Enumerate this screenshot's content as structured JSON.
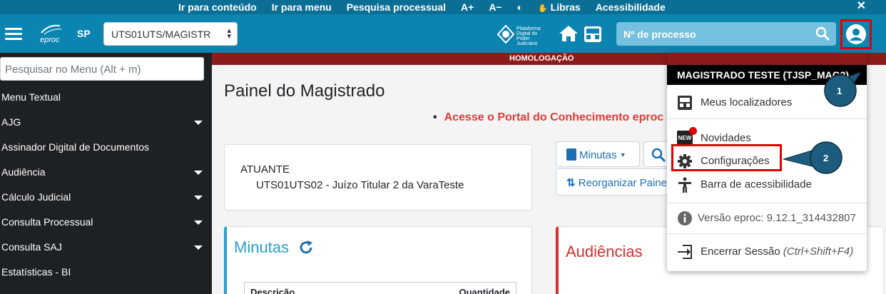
{
  "accessibility_bar": {
    "links": [
      "Ir para conteúdo",
      "Ir para menu",
      "Pesquisa processual",
      "A+",
      "A−",
      "◐",
      "Libras",
      "Acessibilidade"
    ],
    "close": "✕"
  },
  "header": {
    "logo_text": "eproc",
    "state": "SP",
    "unit_select_value": "UTS01UTS/MAGISTR",
    "pdpj_text": "Plataforma Digital do Poder Judiciário",
    "process_search_placeholder": "Nº de processo"
  },
  "sidebar": {
    "search_placeholder": "Pesquisar no Menu (Alt + m)",
    "items": [
      {
        "label": "Menu Textual",
        "expandable": false
      },
      {
        "label": "AJG",
        "expandable": true
      },
      {
        "label": "Assinador Digital de Documentos",
        "expandable": false
      },
      {
        "label": "Audiência",
        "expandable": true
      },
      {
        "label": "Cálculo Judicial",
        "expandable": true
      },
      {
        "label": "Consulta Processual",
        "expandable": true
      },
      {
        "label": "Consulta SAJ",
        "expandable": true
      },
      {
        "label": "Estatísticas - BI",
        "expandable": false
      }
    ]
  },
  "main": {
    "environment_banner": "HOMOLOGAÇÃO",
    "page_title": "Painel do Magistrado",
    "portal_link": "Acesse o Portal do Conhecimento eproc",
    "actuant_label": "ATUANTE",
    "actuant_value": "UTS01UTS02 - Juízo Titular 2 da VaraTeste",
    "minutas_button": "Minutas",
    "reorganize_button": "Reorganizar Painel",
    "minutas_panel_title": "Minutas",
    "minutas_table_col1": "Descrição",
    "minutas_table_col2": "Quantidade",
    "audiencias_panel_title": "Audiências"
  },
  "user_dropdown": {
    "user_name": "MAGISTRADO TESTE (TJSP_MAG2)",
    "items": {
      "localizadores": "Meus localizadores",
      "novidades": "Novidades",
      "novidades_badge": "NEW",
      "configuracoes": "Configurações",
      "acessibilidade": "Barra de acessibilidade",
      "versao": "Versão eproc: 9.12.1_314432807",
      "sair": "Encerrar Sessão",
      "sair_shortcut": "(Ctrl+Shift+F4)"
    }
  },
  "callouts": {
    "one": "1",
    "two": "2"
  },
  "colors": {
    "header_blue": "#0b84b0",
    "bar_blue": "#0b6e95",
    "sidebar_dark": "#1e2124",
    "highlight_red": "#e00000",
    "homologacao_red": "#8d1b1b",
    "callout_blue": "#1c5d7e"
  }
}
